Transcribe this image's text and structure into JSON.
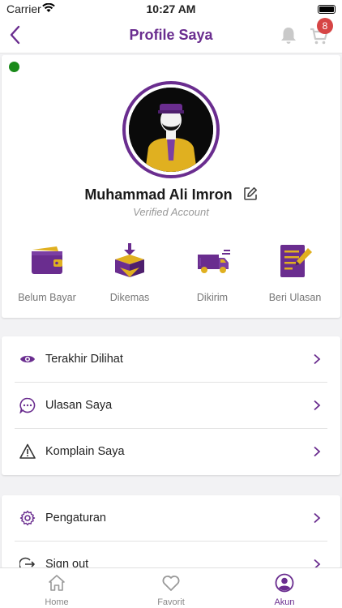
{
  "status_bar": {
    "carrier": "Carrier",
    "time": "10:27 AM"
  },
  "header": {
    "title": "Profile Saya",
    "cart_count": "8"
  },
  "profile": {
    "name": "Muhammad Ali Imron",
    "subtitle": "Verified Account",
    "online_color": "#1a8a1a"
  },
  "orders": [
    {
      "label": "Belum Bayar",
      "icon": "wallet-icon"
    },
    {
      "label": "Dikemas",
      "icon": "package-icon"
    },
    {
      "label": "Dikirim",
      "icon": "truck-icon"
    },
    {
      "label": "Beri Ulasan",
      "icon": "review-icon"
    }
  ],
  "menu1": [
    {
      "label": "Terakhir Dilihat",
      "icon": "eye-icon"
    },
    {
      "label": "Ulasan Saya",
      "icon": "chat-icon"
    },
    {
      "label": "Komplain Saya",
      "icon": "warning-icon"
    }
  ],
  "menu2": [
    {
      "label": "Pengaturan",
      "icon": "gear-icon"
    },
    {
      "label": "Sign out",
      "icon": "sign-out-icon"
    }
  ],
  "nav": [
    {
      "label": "Home",
      "icon": "home-icon"
    },
    {
      "label": "Favorit",
      "icon": "heart-icon"
    },
    {
      "label": "Akun",
      "icon": "account-icon",
      "active": true
    }
  ],
  "colors": {
    "accent": "#6a2d8f",
    "accent_light": "#7b3fa3",
    "gold": "#e0b020",
    "badge": "#d64545"
  }
}
